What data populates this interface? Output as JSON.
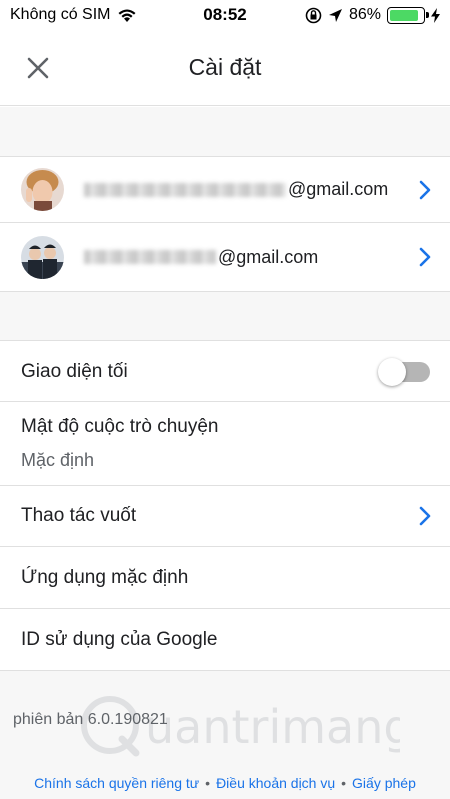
{
  "status": {
    "carrier": "Không có SIM",
    "time": "08:52",
    "battery": "86%",
    "battery_level": 0.86,
    "icons": [
      "wifi-icon",
      "orientation-lock-icon",
      "location-arrow-icon",
      "battery-icon",
      "charging-bolt-icon"
    ]
  },
  "header": {
    "title": "Cài đặt",
    "close_icon": "close-icon"
  },
  "accounts": [
    {
      "email_suffix": "@gmail.com",
      "avatar": "avatar-1"
    },
    {
      "email_suffix": "@gmail.com",
      "avatar": "avatar-2"
    }
  ],
  "settings": {
    "dark_theme": {
      "label": "Giao diện tối",
      "enabled": false
    },
    "density": {
      "label": "Mật độ cuộc trò chuyện",
      "value": "Mặc định"
    },
    "swipe": {
      "label": "Thao tác vuốt"
    },
    "default_apps": {
      "label": "Ứng dụng mặc định"
    },
    "google_id": {
      "label": "ID sử dụng của Google"
    }
  },
  "footer": {
    "version": "phiên bản 6.0.190821",
    "watermark": "uantrimang",
    "links": [
      "Chính sách quyền riêng tư",
      "Điều khoản dịch vụ",
      "Giấy phép"
    ]
  },
  "colors": {
    "accent": "#1a73e8",
    "battery_green": "#4cd964"
  }
}
